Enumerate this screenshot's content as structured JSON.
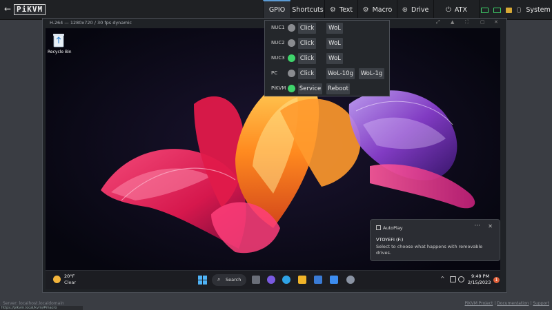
{
  "nav": {
    "back_glyph": "←",
    "logo": "PiKVM",
    "tabs": {
      "gpio": "GPIO",
      "shortcuts": "Shortcuts",
      "text": "Text",
      "macro": "Macro",
      "drive": "Drive",
      "atx": "ATX",
      "system": "System"
    },
    "icons": {
      "text": "gear-icon",
      "macro": "gear-icon",
      "drive": "drive-icon",
      "atx": "power-icon"
    },
    "status_led_colors": [
      "#3fd46b",
      "#3fd46b",
      "#777777",
      "#d8a935",
      "#777777"
    ]
  },
  "gpio": {
    "rows": [
      {
        "name": "NUC1",
        "state": "off",
        "buttons": [
          "Click",
          "WoL"
        ]
      },
      {
        "name": "NUC2",
        "state": "off",
        "buttons": [
          "Click",
          "WoL"
        ]
      },
      {
        "name": "NUC3",
        "state": "on",
        "buttons": [
          "Click",
          "WoL"
        ]
      },
      {
        "name": "PC",
        "state": "off",
        "buttons": [
          "Click",
          "WoL-10g",
          "WoL-1g"
        ]
      },
      {
        "name": "PiKVM",
        "state": "on",
        "buttons": [
          "Service",
          "Reboot"
        ]
      }
    ],
    "on_color": "#3fd46b",
    "off_color": "#8a8c90"
  },
  "stream": {
    "title": "H.264 — 1280x720 / 30 fps dynamic"
  },
  "desktop": {
    "recycle_bin_label": "Recycle Bin"
  },
  "notification": {
    "app": "AutoPlay",
    "more": "···",
    "close": "✕",
    "title": "VTOYEFI (F:)",
    "body": "Select to choose what happens with removable drives."
  },
  "taskbar": {
    "weather_temp": "20°F",
    "weather_desc": "Clear",
    "search_label": "Search",
    "search_glyph": "⌕",
    "tray_chevron": "^",
    "time": "9:49 PM",
    "date": "2/15/2023",
    "badge": "1",
    "app_colors": [
      "#6a6e78",
      "#7a5ae0",
      "#2fa3e6",
      "#3a7bd5",
      "#f0b429",
      "#3d8df0",
      "#8a93a3"
    ]
  },
  "status": {
    "server": "Server: localhost.localdomain",
    "url": "https://pikvm.local/kvm/#macro",
    "links": [
      "PiKVM Project",
      "Documentation",
      "Support"
    ]
  },
  "accent_color": "#5b9bd5"
}
